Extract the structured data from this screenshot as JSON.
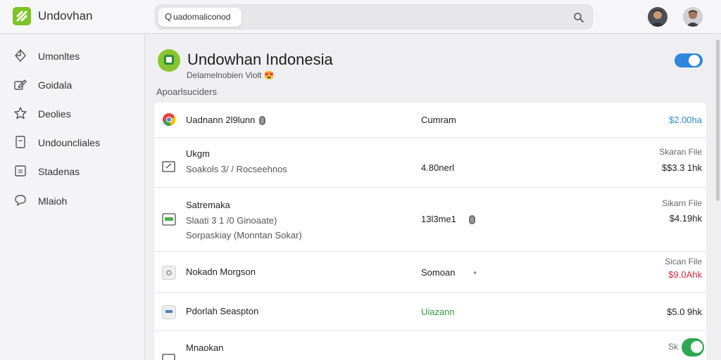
{
  "app": {
    "title": "Undovhan"
  },
  "search": {
    "query_prefix": "Q",
    "value": "uadomaliconod"
  },
  "sidebar": {
    "items": [
      {
        "label": "Umonltes",
        "icon": "diamond-icon"
      },
      {
        "label": "Goidala",
        "icon": "edit-icon"
      },
      {
        "label": "Deolies",
        "icon": "star-icon"
      },
      {
        "label": "Undouncliales",
        "icon": "document-icon"
      },
      {
        "label": "Stadenas",
        "icon": "list-icon"
      },
      {
        "label": "Mlaioh",
        "icon": "chat-icon"
      }
    ]
  },
  "account": {
    "title": "Undowhan Indonesia",
    "subtitle": "Delamelnobien Violt",
    "subtitle_emoji": "😍"
  },
  "section": {
    "label": "Apoarlsuciders"
  },
  "rows": [
    {
      "name": "Uadnann 2l9lunn",
      "sub": "",
      "sub2": "",
      "mid": "Cumram",
      "right_label": "",
      "right_value": "$2.00ha",
      "right_color": "#2a8ad4"
    },
    {
      "name": "Ukgm",
      "sub": "Soakols 3/ / Rocseehnos",
      "sub2": "",
      "mid": "4.80nerl",
      "right_label": "Skaran File",
      "right_value": "$$3.3 1hk",
      "right_color": "#222222"
    },
    {
      "name": "Satremaka",
      "sub": "Slaati 3 1 /0 Ginoaate)",
      "sub2": "Sorpaskiay (Monntan Sokar)",
      "mid": "13l3me1",
      "right_label": "Sikarn File",
      "right_value": "$4.19hk",
      "right_color": "#222222"
    },
    {
      "name": "Nokadn Morgson",
      "sub": "",
      "sub2": "",
      "mid": "Somoan",
      "right_label": "Sican File",
      "right_value": "$9.0Ahk",
      "right_color": "#d8283a"
    },
    {
      "name": "Pdorlah Seaspton",
      "sub": "",
      "sub2": "",
      "mid": "Uiazann",
      "right_label": "",
      "right_value": "$5.0 9hk",
      "right_color": "#222222"
    },
    {
      "name": "Mnaokan",
      "sub": "",
      "sub2": "",
      "mid": "",
      "right_label": "Sk",
      "right_value": "",
      "right_color": "#222222"
    }
  ],
  "colors": {
    "accent_blue": "#2e86de",
    "brand_green": "#7cc423",
    "toggle_on": "#2fa84f",
    "price_red": "#d8283a",
    "status_green": "#2e9b3c"
  }
}
